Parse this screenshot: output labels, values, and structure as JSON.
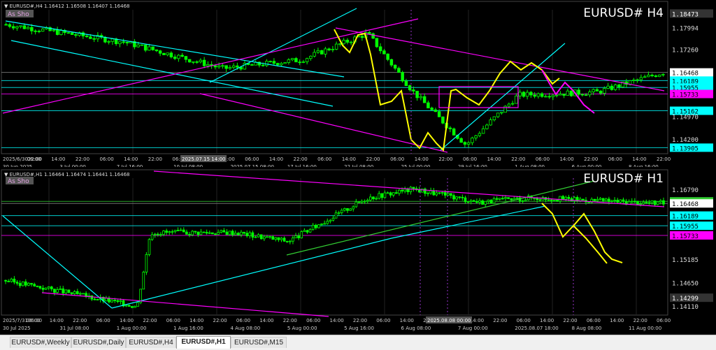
{
  "colors": {
    "candle": "#00ff00",
    "price_box": "#00ffff",
    "magenta": "#ff00ff",
    "cyan": "#00ffff",
    "yellow": "#ffff00",
    "green": "#32cd32",
    "grid": "#303030",
    "axis_text": "#ffffff"
  },
  "chart_data": [
    {
      "type": "candlestick",
      "symbol_title": "EURUSD# H4",
      "header": "▼ EURUSD#,H4  1.16412 1.16508 1.16407 1.16468",
      "badge": "As Sho",
      "ylim": [
        1.137,
        1.186
      ],
      "x_ticks": [
        "2025/6/3022:00",
        "06:00",
        "14:00",
        "22:00",
        "06:00",
        "14:00",
        "22:00",
        "06:00",
        "14:00",
        "22:00",
        "06:00",
        "14:00",
        "22:00",
        "06:00",
        "14:00",
        "22:00",
        "06:00",
        "14:00",
        "22:00",
        "06:00",
        "14:00",
        "22:00",
        "06:00",
        "14:00",
        "22:00",
        "06:00",
        "14:00",
        "22:00"
      ],
      "x_ticks_bottom": [
        "30 Jun 2025",
        "3 Jul 00:00",
        "7 Jul 16:00",
        "10 Jul 08:00",
        "2025.07.15 08:00",
        "17 Jul 16:00",
        "22 Jul 08:00",
        "25 Jul 00:00",
        "29 Jul 16:00",
        "1 Aug 08:00",
        "6 Aug 00:00",
        "8 Aug 16:00"
      ],
      "highlight_tick": "2025.07.15 14:00",
      "price_levels": [
        {
          "value": 1.18473,
          "label": "1.18473",
          "style": "box"
        },
        {
          "value": 1.17994,
          "label": "1.17994",
          "style": "plain"
        },
        {
          "value": 1.1726,
          "label": "1.17260",
          "style": "plain"
        },
        {
          "value": 1.16468,
          "label": "1.16468",
          "style": "white"
        },
        {
          "value": 1.16189,
          "label": "1.16189",
          "style": "cyan"
        },
        {
          "value": 1.15955,
          "label": "1.15955",
          "style": "cyan"
        },
        {
          "value": 1.15733,
          "label": "1.15733",
          "style": "magenta"
        },
        {
          "value": 1.15162,
          "label": "1.15162",
          "style": "cyan"
        },
        {
          "value": 1.1497,
          "label": "1.14970",
          "style": "plain"
        },
        {
          "value": 1.142,
          "label": "1.14200",
          "style": "plain"
        },
        {
          "value": 1.13905,
          "label": "1.13905",
          "style": "cyan"
        }
      ],
      "bars": 180
    },
    {
      "type": "candlestick",
      "symbol_title": "EURUSD# H1",
      "header": "▼ EURUSD#,H1  1.16464 1.16474 1.16441 1.16468",
      "badge": "As Sho",
      "ylim": [
        1.139,
        1.1705
      ],
      "x_ticks": [
        "2025/7/3106:00",
        "06:00",
        "14:00",
        "22:00",
        "06:00",
        "14:00",
        "22:00",
        "06:00",
        "14:00",
        "22:00",
        "06:00",
        "14:00",
        "22:00",
        "06:00",
        "14:00",
        "22:00",
        "06:00",
        "14:00",
        "22:00",
        "06:00",
        "14:00",
        "22:00",
        "06:00",
        "14:00",
        "22:00",
        "06:00",
        "14:00",
        "22:00",
        "06:00"
      ],
      "x_ticks_bottom": [
        "30 Jul 2025",
        "31 Jul 08:00",
        "1 Aug 00:00",
        "1 Aug 16:00",
        "4 Aug 08:00",
        "5 Aug 00:00",
        "5 Aug 16:00",
        "6 Aug 08:00",
        "7 Aug 00:00",
        "2025.08.07 18:00",
        "8 Aug 08:00",
        "11 Aug 00:00"
      ],
      "highlight_tick": "2025.08.08 00:00",
      "price_levels": [
        {
          "value": 1.1679,
          "label": "1.16790",
          "style": "plain"
        },
        {
          "value": 1.16516,
          "label": "1.16516",
          "style": "green"
        },
        {
          "value": 1.16468,
          "label": "1.16468",
          "style": "white"
        },
        {
          "value": 1.16189,
          "label": "1.16189",
          "style": "cyan"
        },
        {
          "value": 1.15955,
          "label": "1.15955",
          "style": "cyan"
        },
        {
          "value": 1.15733,
          "label": "1.15733",
          "style": "magenta"
        },
        {
          "value": 1.15185,
          "label": "1.15185",
          "style": "plain"
        },
        {
          "value": 1.1465,
          "label": "1.14650",
          "style": "plain"
        },
        {
          "value": 1.14299,
          "label": "1.14299",
          "style": "boxgrey"
        },
        {
          "value": 1.1411,
          "label": "1.14110",
          "style": "plain"
        }
      ],
      "bars": 230
    }
  ],
  "tabs": [
    {
      "label": "EURUSD#,Weekly",
      "active": false
    },
    {
      "label": "EURUSD#,Daily",
      "active": false
    },
    {
      "label": "EURUSD#,H4",
      "active": false
    },
    {
      "label": "EURUSD#,H1",
      "active": true
    },
    {
      "label": "EURUSD#,M15",
      "active": false
    }
  ]
}
